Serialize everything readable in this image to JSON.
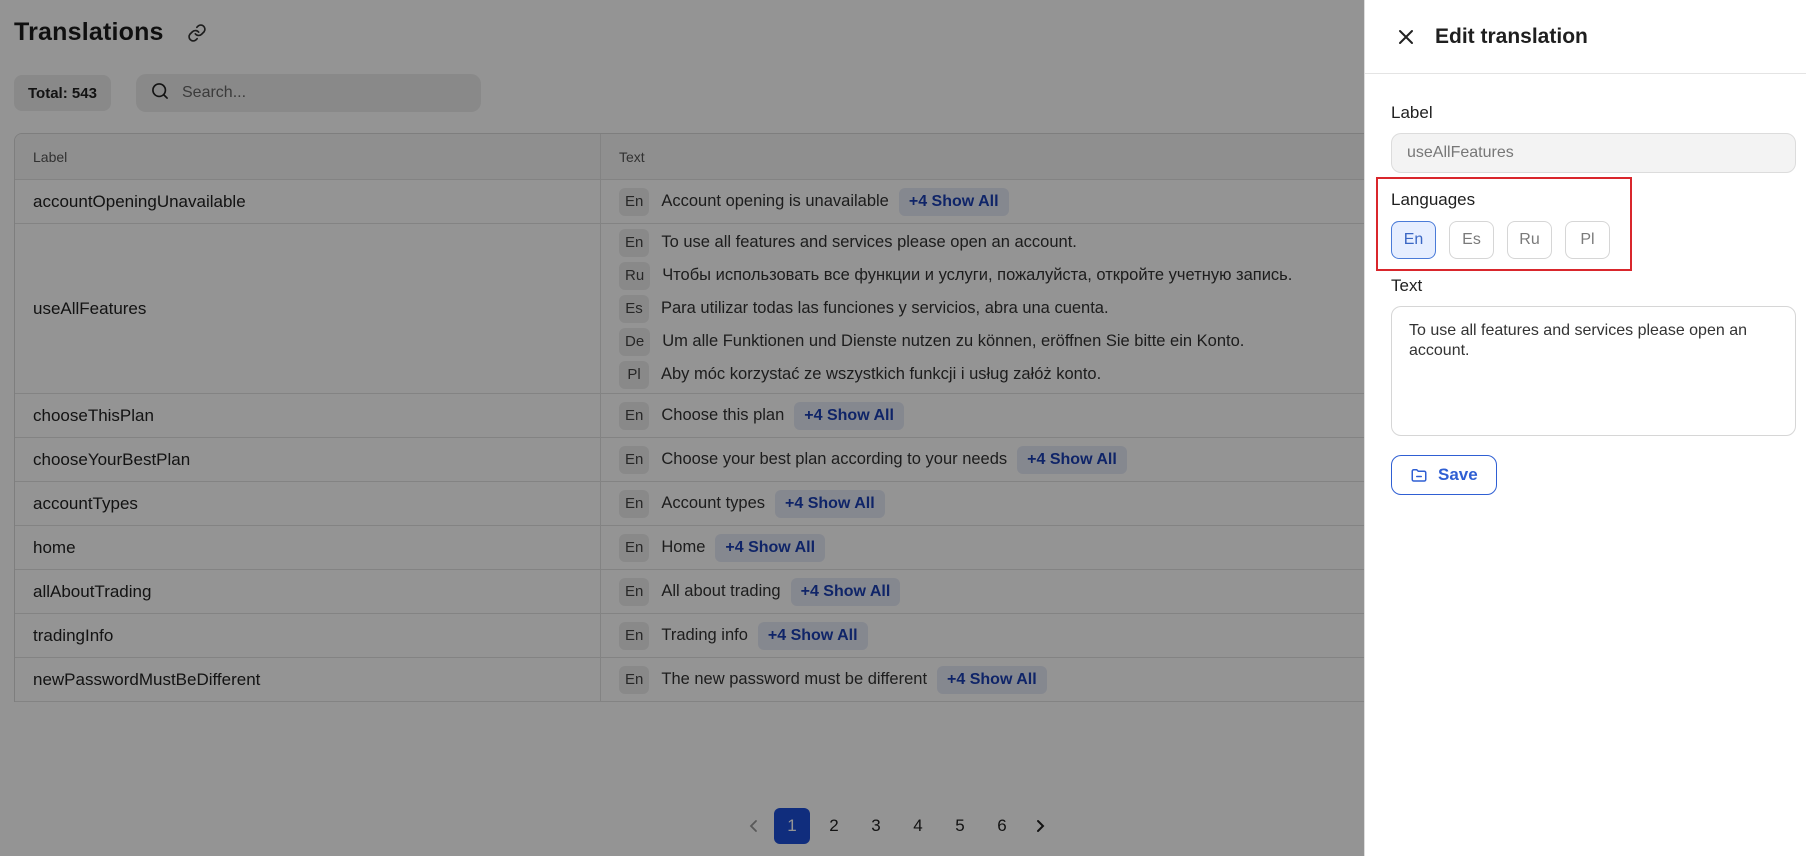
{
  "page": {
    "title": "Translations",
    "total_label": "Total: 543",
    "search_placeholder": "Search..."
  },
  "table": {
    "headers": {
      "label": "Label",
      "text": "Text"
    },
    "rows": [
      {
        "label": "accountOpeningUnavailable",
        "lines": [
          {
            "lang": "En",
            "text": "Account opening is unavailable"
          }
        ],
        "show_all": "+4 Show All"
      },
      {
        "label": "useAllFeatures",
        "lines": [
          {
            "lang": "En",
            "text": "To use all features and services please open an account."
          },
          {
            "lang": "Ru",
            "text": "Чтобы использовать все функции и услуги, пожалуйста, откройте учетную запись."
          },
          {
            "lang": "Es",
            "text": "Para utilizar todas las funciones y servicios, abra una cuenta."
          },
          {
            "lang": "De",
            "text": "Um alle Funktionen und Dienste nutzen zu können, eröffnen Sie bitte ein Konto."
          },
          {
            "lang": "Pl",
            "text": "Aby móc korzystać ze wszystkich funkcji i usług załóż konto."
          }
        ],
        "show_all": ""
      },
      {
        "label": "chooseThisPlan",
        "lines": [
          {
            "lang": "En",
            "text": "Choose this plan"
          }
        ],
        "show_all": "+4 Show All"
      },
      {
        "label": "chooseYourBestPlan",
        "lines": [
          {
            "lang": "En",
            "text": "Choose your best plan according to your needs"
          }
        ],
        "show_all": "+4 Show All"
      },
      {
        "label": "accountTypes",
        "lines": [
          {
            "lang": "En",
            "text": "Account types"
          }
        ],
        "show_all": "+4 Show All"
      },
      {
        "label": "home",
        "lines": [
          {
            "lang": "En",
            "text": "Home"
          }
        ],
        "show_all": "+4 Show All"
      },
      {
        "label": "allAboutTrading",
        "lines": [
          {
            "lang": "En",
            "text": "All about trading"
          }
        ],
        "show_all": "+4 Show All"
      },
      {
        "label": "tradingInfo",
        "lines": [
          {
            "lang": "En",
            "text": "Trading info"
          }
        ],
        "show_all": "+4 Show All"
      },
      {
        "label": "newPasswordMustBeDifferent",
        "lines": [
          {
            "lang": "En",
            "text": "The new password must be different"
          }
        ],
        "show_all": "+4 Show All"
      }
    ]
  },
  "pagination": {
    "pages": [
      "1",
      "2",
      "3",
      "4",
      "5",
      "6"
    ],
    "current": "1"
  },
  "drawer": {
    "title": "Edit translation",
    "label_field_label": "Label",
    "label_value": "useAllFeatures",
    "languages_label": "Languages",
    "languages": [
      "En",
      "Es",
      "Ru",
      "Pl"
    ],
    "active_language": "En",
    "text_label": "Text",
    "text_value": "To use all features and services please open an account.",
    "save_label": "Save"
  },
  "colors": {
    "accent": "#1d4ed8",
    "highlight": "#d9262c",
    "show_all_text": "#1a3fb3"
  }
}
